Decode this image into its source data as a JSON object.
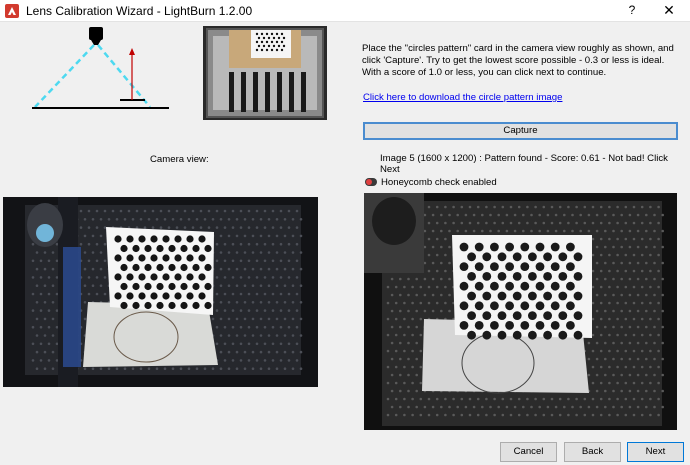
{
  "window": {
    "title": "Lens Calibration Wizard - LightBurn 1.2.00",
    "help_label": "?",
    "close_label": "✕"
  },
  "instructions": "Place the \"circles pattern\" card in the camera view roughly as shown, and click 'Capture'. Try to get the lowest score possible - 0.3 or less is ideal. With a score of 1.0 or less, you can click next to continue.",
  "download_link": "Click here to download the circle pattern image",
  "capture_label": "Capture",
  "status": "Image 5 (1600 x 1200) : Pattern found - Score: 0.61 - Not bad! Click Next",
  "camera_view_label": "Camera view:",
  "honeycomb": {
    "label": "Honeycomb check enabled",
    "enabled": false
  },
  "buttons": {
    "cancel": "Cancel",
    "back": "Back",
    "next": "Next"
  },
  "colors": {
    "accent": "#0078d7",
    "link": "#0000ee",
    "dashed_line": "#4dd9f0",
    "arrow": "#c00000"
  },
  "icons": {
    "app": "lightburn-logo-icon",
    "help": "help-icon",
    "close": "close-icon"
  }
}
